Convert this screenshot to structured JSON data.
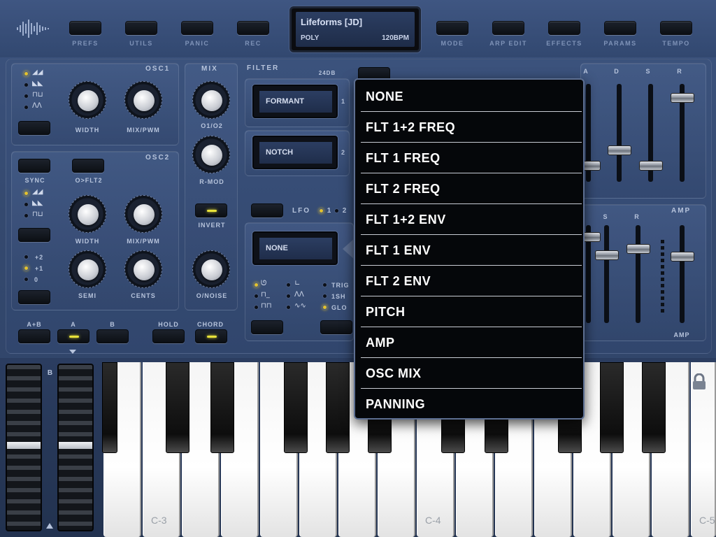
{
  "topbar": {
    "buttons": [
      {
        "label": "PREFS"
      },
      {
        "label": "UTILS"
      },
      {
        "label": "PANIC"
      },
      {
        "label": "REC"
      },
      {
        "label": "MODE"
      },
      {
        "label": "ARP EDIT"
      },
      {
        "label": "EFFECTS"
      },
      {
        "label": "PARAMS"
      },
      {
        "label": "TEMPO"
      }
    ],
    "display": {
      "title": "Lifeforms [JD]",
      "mode": "POLY",
      "bpm": "120BPM"
    }
  },
  "osc1": {
    "title": "OSC1",
    "knobs": {
      "width": "WIDTH",
      "mix": "MIX/PWM"
    }
  },
  "osc2": {
    "title": "OSC2",
    "sync": "SYNC",
    "o_flt2": "O>FLT2",
    "knobs": {
      "width": "WIDTH",
      "mix": "MIX/PWM",
      "semi": "SEMI",
      "cents": "CENTS"
    },
    "octave": [
      "+2",
      "+1",
      "0"
    ]
  },
  "mix": {
    "title": "MIX",
    "o1o2": "O1/O2",
    "rmod": "R-MOD",
    "invert": "INVERT",
    "onoise": "O/NOISE"
  },
  "filter": {
    "title": "FILTER",
    "slope": "24DB",
    "filter1": "FORMANT",
    "filter1_num": "1",
    "filter2": "NOTCH",
    "filter2_num": "2"
  },
  "lfo": {
    "title": "LFO",
    "num1": "1",
    "num2": "2",
    "target": "NONE",
    "opts": [
      "TRIG",
      "1SH",
      "GLO"
    ]
  },
  "bottom_buttons": {
    "ab": "A+B",
    "a": "A",
    "b": "B",
    "hold": "HOLD",
    "chord": "CHORD"
  },
  "env": {
    "labels": [
      "A",
      "D",
      "S",
      "R"
    ]
  },
  "amp": {
    "title": "AMP",
    "labels": [
      "S",
      "R"
    ],
    "bottom": "AMP"
  },
  "modwheel": {
    "label": "B"
  },
  "keyboard": {
    "labels": [
      "C-3",
      "C-4",
      "C-5"
    ]
  },
  "dropdown": {
    "items": [
      "NONE",
      "FLT 1+2 FREQ",
      "FLT 1 FREQ",
      "FLT 2 FREQ",
      "FLT 1+2 ENV",
      "FLT 1 ENV",
      "FLT 2 ENV",
      "PITCH",
      "AMP",
      "OSC MIX",
      "PANNING"
    ]
  },
  "colors": {
    "accent": "#e8e23a",
    "panel": "#3d5480",
    "popup": "#05070a"
  }
}
